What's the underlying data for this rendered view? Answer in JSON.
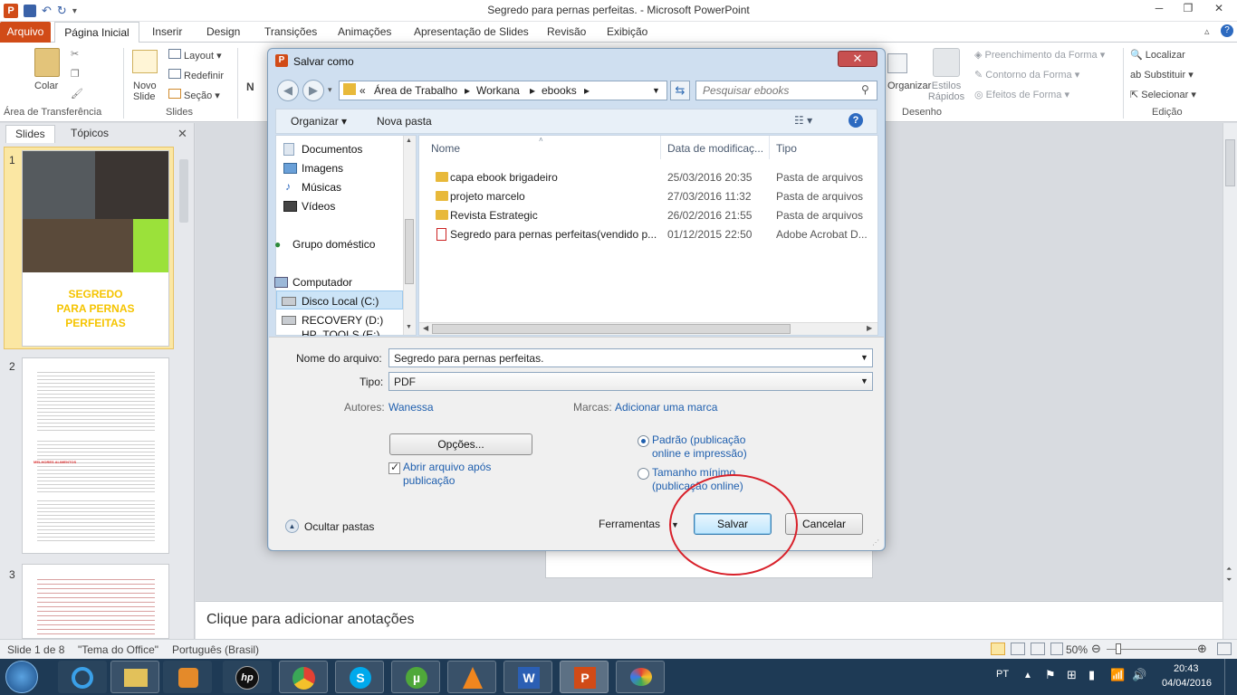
{
  "window": {
    "title": "Segredo para pernas perfeitas. - Microsoft PowerPoint"
  },
  "ribbon_tabs": [
    "Arquivo",
    "Página Inicial",
    "Inserir",
    "Design",
    "Transições",
    "Animações",
    "Apresentação de Slides",
    "Revisão",
    "Exibição"
  ],
  "ribbon": {
    "clipboard": {
      "paste": "Colar",
      "caption": "Área de Transferência"
    },
    "slides": {
      "new_slide": "Novo Slide",
      "layout": "Layout",
      "reset": "Redefinir",
      "section": "Seção",
      "caption": "Slides"
    },
    "drawing": {
      "arrange": "Organizar",
      "quick_styles": "Estilos Rápidos",
      "shape_fill": "Preenchimento da Forma",
      "shape_outline": "Contorno da Forma",
      "shape_effects": "Efeitos de Forma",
      "caption": "Desenho"
    },
    "editing": {
      "find": "Localizar",
      "replace": "Substituir",
      "select": "Selecionar",
      "caption": "Edição"
    }
  },
  "left_pane": {
    "tabs": [
      "Slides",
      "Tópicos"
    ],
    "slide1": {
      "number": "1",
      "title_lines": [
        "SEGREDO",
        "PARA PERNAS",
        "PERFEITAS"
      ]
    },
    "slide2": {
      "number": "2",
      "heading": "MELHORES ALIMENTOS"
    },
    "slide3": {
      "number": "3"
    }
  },
  "notes_placeholder": "Clique para adicionar anotações",
  "status": {
    "slide_info": "Slide 1 de 8",
    "theme": "\"Tema do Office\"",
    "language": "Português (Brasil)",
    "zoom": "50%",
    "zoom_fraction": 0.5
  },
  "taskbar": {
    "lang": "PT",
    "time": "20:43",
    "date": "04/04/2016"
  },
  "dialog": {
    "title": "Salvar como",
    "breadcrumb": [
      "Área de Trabalho",
      "Workana",
      "ebooks"
    ],
    "search_placeholder": "Pesquisar ebooks",
    "organize": "Organizar",
    "new_folder": "Nova pasta",
    "nav": [
      "Documentos",
      "Imagens",
      "Músicas",
      "Vídeos",
      "Grupo doméstico",
      "Computador",
      "Disco Local (C:)",
      "RECOVERY (D:)",
      "HP_TOOLS (E:)"
    ],
    "columns": {
      "name": "Nome",
      "modified": "Data de modificaç...",
      "type": "Tipo"
    },
    "files": [
      {
        "name": "capa ebook brigadeiro",
        "modified": "25/03/2016 20:35",
        "type": "Pasta de arquivos",
        "icon": "folder-icon"
      },
      {
        "name": "projeto marcelo",
        "modified": "27/03/2016 11:32",
        "type": "Pasta de arquivos",
        "icon": "folder-icon"
      },
      {
        "name": "Revista Estrategic",
        "modified": "26/02/2016 21:55",
        "type": "Pasta de arquivos",
        "icon": "folder-icon"
      },
      {
        "name": "Segredo para pernas perfeitas(vendido p...",
        "modified": "01/12/2015 22:50",
        "type": "Adobe Acrobat D...",
        "icon": "pdf-icon"
      }
    ],
    "filename_label": "Nome do arquivo:",
    "filename_value": "Segredo para pernas perfeitas.",
    "type_label": "Tipo:",
    "type_value": "PDF",
    "authors_label": "Autores:",
    "authors_value": "Wanessa",
    "tags_label": "Marcas:",
    "tags_value": "Adicionar uma marca",
    "options_button": "Opções...",
    "open_after_label": "Abrir arquivo após publicação",
    "opt_standard": "Padrão (publicação online e impressão)",
    "opt_minimum": "Tamanho mínimo (publicação online)",
    "hide_folders": "Ocultar pastas",
    "tools": "Ferramentas",
    "save": "Salvar",
    "cancel": "Cancelar"
  }
}
